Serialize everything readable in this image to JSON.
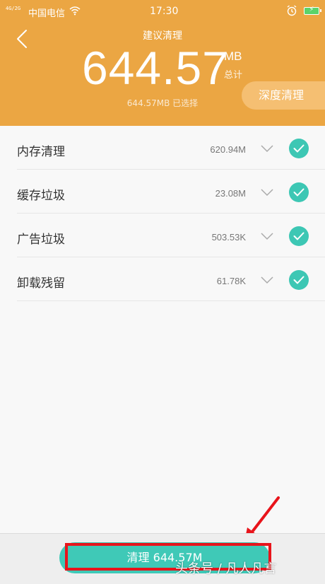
{
  "status_bar": {
    "network": "4G/2G",
    "carrier": "中国电信",
    "time": "17:30"
  },
  "header": {
    "title": "建议清理",
    "total_amount": "644.57",
    "total_unit": "MB",
    "total_label": "总计",
    "selected_summary": "644.57MB 已选择",
    "deep_clean_label": "深度清理"
  },
  "items": [
    {
      "label": "内存清理",
      "size": "620.94M",
      "checked": true
    },
    {
      "label": "缓存垃圾",
      "size": "23.08M",
      "checked": true
    },
    {
      "label": "广告垃圾",
      "size": "503.53K",
      "checked": true
    },
    {
      "label": "卸载残留",
      "size": "61.78K",
      "checked": true
    }
  ],
  "footer": {
    "clean_button_label": "清理 644.57M"
  },
  "watermark": "头条号 / 凡人凡言",
  "colors": {
    "header_bg": "#eba643",
    "accent_teal": "#3fc9b7",
    "annotation_red": "#e8141b"
  },
  "icons": {
    "back": "chevron-left-icon",
    "expand": "chevron-down-icon",
    "check": "check-circle-icon"
  }
}
